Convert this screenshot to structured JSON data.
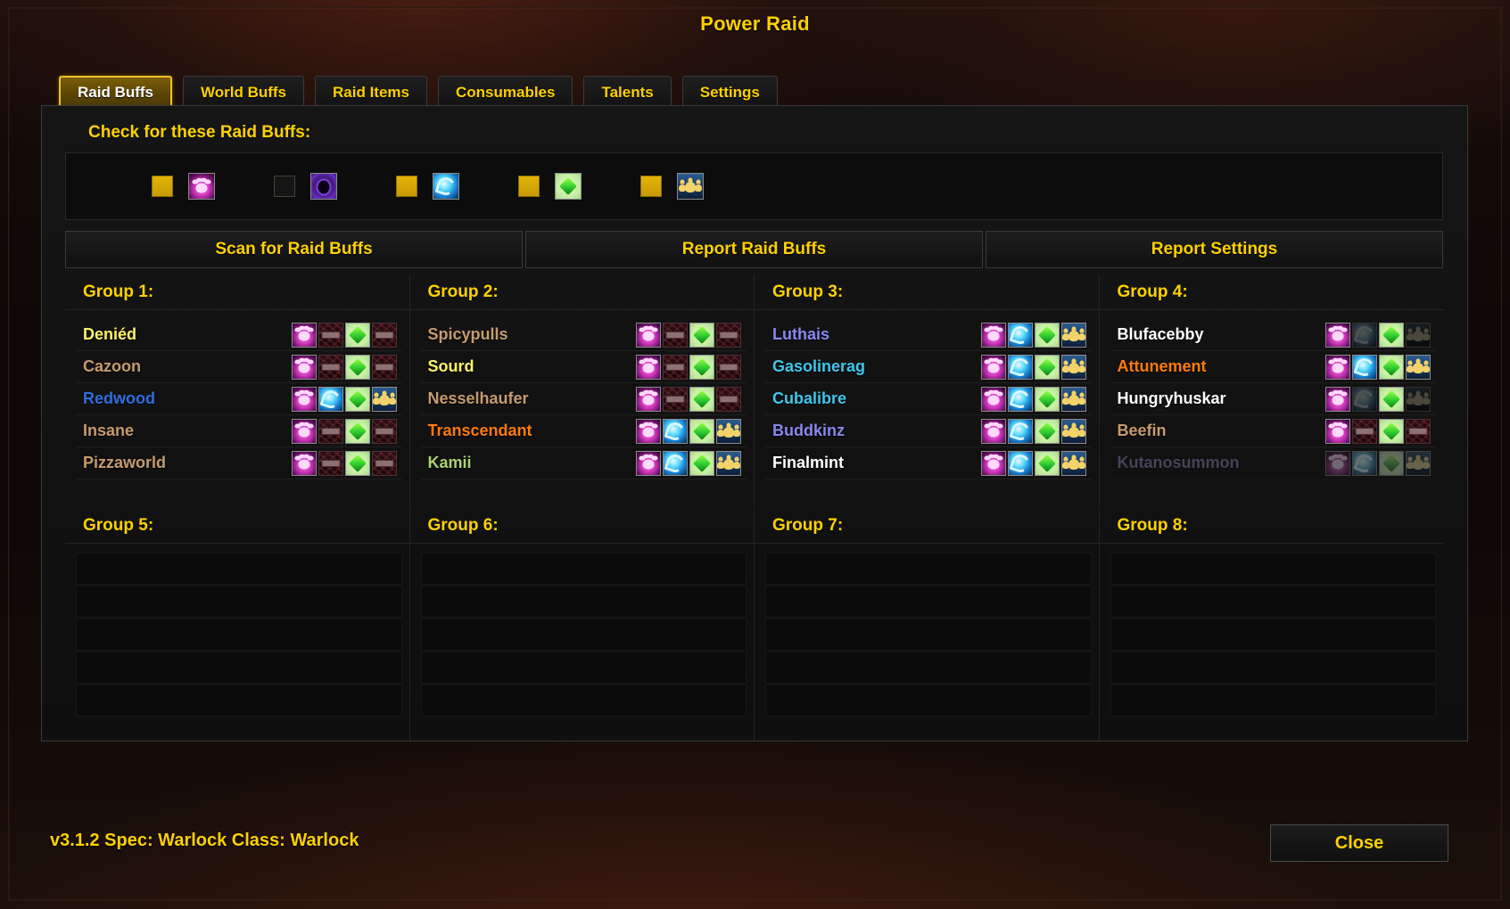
{
  "window": {
    "title": "Power Raid"
  },
  "tabs": [
    {
      "label": "Raid Buffs",
      "active": true
    },
    {
      "label": "World Buffs",
      "active": false
    },
    {
      "label": "Raid Items",
      "active": false
    },
    {
      "label": "Consumables",
      "active": false
    },
    {
      "label": "Talents",
      "active": false
    },
    {
      "label": "Settings",
      "active": false
    }
  ],
  "section": {
    "label": "Check for these Raid Buffs:"
  },
  "buff_checks": [
    {
      "icon": "mark-of-the-wild-icon",
      "checked": true
    },
    {
      "icon": "shadow-protection-icon",
      "checked": false
    },
    {
      "icon": "arcane-intellect-icon",
      "checked": true
    },
    {
      "icon": "divine-spirit-icon",
      "checked": true
    },
    {
      "icon": "blessing-kings-icon",
      "checked": true
    }
  ],
  "actions": [
    {
      "label": "Scan for Raid Buffs"
    },
    {
      "label": "Report Raid Buffs"
    },
    {
      "label": "Report Settings"
    }
  ],
  "colors": {
    "gold": "#ffd100",
    "rogue": "#fff468",
    "warrior": "#c69b6d",
    "shaman": "#2f6fdd",
    "druid": "#ff7c0a",
    "hunter": "#aad372",
    "warlock": "#8788ee",
    "mage": "#3fc7eb",
    "priest": "#ffffff"
  },
  "groups": [
    {
      "title": "Group 1:",
      "members": [
        {
          "name": "Deniéd",
          "color": "#fff468",
          "offline": false,
          "buffs": [
            "mark-of-the-wild-icon",
            "missing-icon",
            "divine-spirit-icon",
            "missing-icon"
          ]
        },
        {
          "name": "Cazoon",
          "color": "#c69b6d",
          "offline": false,
          "buffs": [
            "mark-of-the-wild-icon",
            "missing-icon",
            "divine-spirit-icon",
            "missing-icon"
          ]
        },
        {
          "name": "Redwood",
          "color": "#2f6fdd",
          "offline": false,
          "buffs": [
            "mark-of-the-wild-icon",
            "arcane-intellect-icon",
            "divine-spirit-icon",
            "blessing-kings-icon"
          ]
        },
        {
          "name": "Insane",
          "color": "#c69b6d",
          "offline": false,
          "buffs": [
            "mark-of-the-wild-icon",
            "missing-icon",
            "divine-spirit-icon",
            "missing-icon"
          ]
        },
        {
          "name": "Pizzaworld",
          "color": "#c69b6d",
          "offline": false,
          "buffs": [
            "mark-of-the-wild-icon",
            "missing-icon",
            "divine-spirit-icon",
            "missing-icon"
          ]
        }
      ]
    },
    {
      "title": "Group 2:",
      "members": [
        {
          "name": "Spicypulls",
          "color": "#c69b6d",
          "offline": false,
          "buffs": [
            "mark-of-the-wild-icon",
            "missing-icon",
            "divine-spirit-icon",
            "missing-icon"
          ]
        },
        {
          "name": "Sourd",
          "color": "#fff468",
          "offline": false,
          "buffs": [
            "mark-of-the-wild-icon",
            "missing-icon",
            "divine-spirit-icon",
            "missing-icon"
          ]
        },
        {
          "name": "Nesselhaufer",
          "color": "#c69b6d",
          "offline": false,
          "buffs": [
            "mark-of-the-wild-icon",
            "missing-icon",
            "divine-spirit-icon",
            "missing-icon"
          ]
        },
        {
          "name": "Transcendant",
          "color": "#ff7c0a",
          "offline": false,
          "buffs": [
            "mark-of-the-wild-icon",
            "arcane-intellect-icon",
            "divine-spirit-icon",
            "blessing-kings-icon"
          ]
        },
        {
          "name": "Kamii",
          "color": "#aad372",
          "offline": false,
          "buffs": [
            "mark-of-the-wild-icon",
            "arcane-intellect-icon",
            "divine-spirit-icon",
            "blessing-kings-icon"
          ]
        }
      ]
    },
    {
      "title": "Group 3:",
      "members": [
        {
          "name": "Luthais",
          "color": "#8788ee",
          "offline": false,
          "buffs": [
            "mark-of-the-wild-icon",
            "arcane-intellect-icon",
            "divine-spirit-icon",
            "blessing-kings-icon"
          ]
        },
        {
          "name": "Gasolinerag",
          "color": "#3fc7eb",
          "offline": false,
          "buffs": [
            "mark-of-the-wild-icon",
            "arcane-intellect-icon",
            "divine-spirit-icon",
            "blessing-kings-icon"
          ]
        },
        {
          "name": "Cubalibre",
          "color": "#3fc7eb",
          "offline": false,
          "buffs": [
            "mark-of-the-wild-icon",
            "arcane-intellect-icon",
            "divine-spirit-icon",
            "blessing-kings-icon"
          ]
        },
        {
          "name": "Buddkinz",
          "color": "#8788ee",
          "offline": false,
          "buffs": [
            "mark-of-the-wild-icon",
            "arcane-intellect-icon",
            "divine-spirit-icon",
            "blessing-kings-icon"
          ]
        },
        {
          "name": "Finalmint",
          "color": "#ffffff",
          "offline": false,
          "buffs": [
            "mark-of-the-wild-icon",
            "arcane-intellect-icon",
            "divine-spirit-icon",
            "blessing-kings-icon"
          ]
        }
      ]
    },
    {
      "title": "Group 4:",
      "members": [
        {
          "name": "Blufacebby",
          "color": "#ffffff",
          "offline": false,
          "buffs": [
            "mark-of-the-wild-icon",
            "arcane-intellect-icon-dim",
            "divine-spirit-icon",
            "blessing-kings-icon-dim"
          ]
        },
        {
          "name": "Attunement",
          "color": "#ff7c0a",
          "offline": false,
          "buffs": [
            "mark-of-the-wild-icon",
            "arcane-intellect-icon",
            "divine-spirit-icon",
            "blessing-kings-icon"
          ]
        },
        {
          "name": "Hungryhuskar",
          "color": "#ffffff",
          "offline": false,
          "buffs": [
            "mark-of-the-wild-icon",
            "arcane-intellect-icon-dim",
            "divine-spirit-icon",
            "blessing-kings-icon-dim"
          ]
        },
        {
          "name": "Beefin",
          "color": "#c69b6d",
          "offline": false,
          "buffs": [
            "mark-of-the-wild-icon",
            "missing-icon",
            "divine-spirit-icon",
            "missing-icon"
          ]
        },
        {
          "name": "Kutanosummon",
          "color": "#8788ee",
          "offline": true,
          "buffs": [
            "mark-of-the-wild-icon",
            "arcane-intellect-icon",
            "divine-spirit-icon",
            "blessing-kings-icon"
          ]
        }
      ]
    },
    {
      "title": "Group 5:",
      "members": []
    },
    {
      "title": "Group 6:",
      "members": []
    },
    {
      "title": "Group 7:",
      "members": []
    },
    {
      "title": "Group 8:",
      "members": []
    }
  ],
  "footer": {
    "status": "v3.1.2  Spec: Warlock  Class: Warlock",
    "close_label": "Close"
  }
}
